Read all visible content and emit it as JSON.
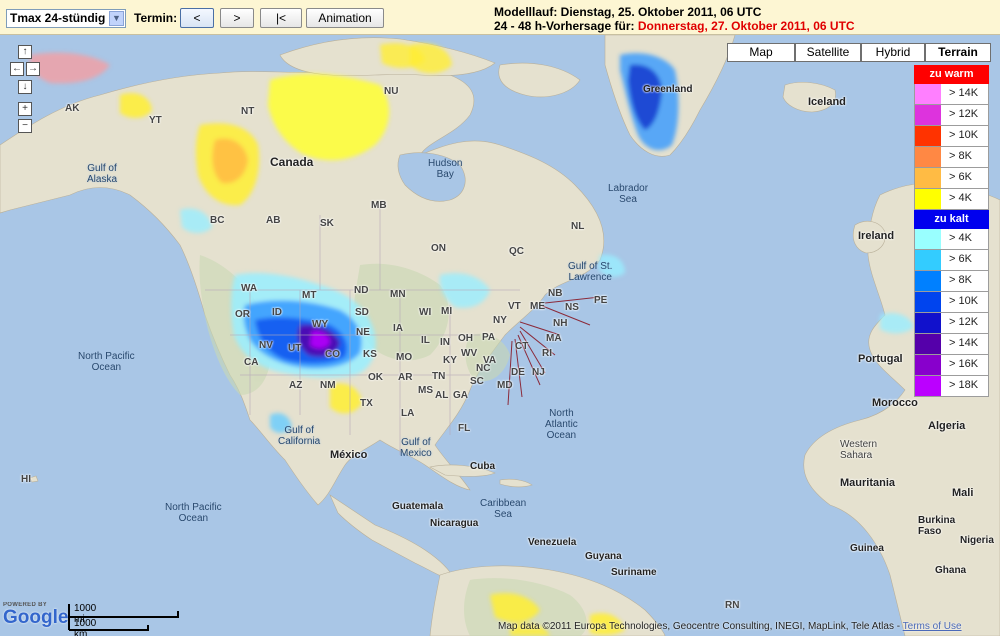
{
  "toolbar": {
    "select_value": "Tmax 24-stündig",
    "termin_label": "Termin:",
    "btn_prev": "<",
    "btn_next": ">",
    "btn_first": "|<",
    "btn_animation": "Animation",
    "run_line": "Modelllauf: Dienstag, 25. Oktober 2011, 06 UTC",
    "forecast_prefix": "24 - 48 h-Vorhersage für: ",
    "forecast_date": "Donnerstag, 27. Oktober 2011, 06 UTC"
  },
  "map_types": [
    "Map",
    "Satellite",
    "Hybrid",
    "Terrain"
  ],
  "map_type_active": "Terrain",
  "pan_controls": {
    "up": "↑",
    "left": "←",
    "right": "→",
    "down": "↓",
    "zoom_in": "+",
    "zoom_out": "−"
  },
  "legend": {
    "warm_title": "zu warm",
    "warm": [
      {
        "label": "> 14K",
        "color": "#ff7fff"
      },
      {
        "label": "> 12K",
        "color": "#dd33dd"
      },
      {
        "label": "> 10K",
        "color": "#ff3300"
      },
      {
        "label": "> 8K",
        "color": "#ff8844"
      },
      {
        "label": "> 6K",
        "color": "#ffbb44"
      },
      {
        "label": "> 4K",
        "color": "#ffff00"
      }
    ],
    "cold_title": "zu kalt",
    "cold": [
      {
        "label": "> 4K",
        "color": "#99ffff"
      },
      {
        "label": "> 6K",
        "color": "#33ccff"
      },
      {
        "label": "> 8K",
        "color": "#0080ff"
      },
      {
        "label": "> 10K",
        "color": "#0044ee"
      },
      {
        "label": "> 12K",
        "color": "#1111cc"
      },
      {
        "label": "> 14K",
        "color": "#5500aa"
      },
      {
        "label": "> 16K",
        "color": "#8800cc"
      },
      {
        "label": "> 18K",
        "color": "#bb00ff"
      }
    ],
    "warm_header_color": "#ff0000",
    "cold_header_color": "#0000ee"
  },
  "labels": {
    "canada": "Canada",
    "mexico": "México",
    "greenland": "Greenland",
    "iceland": "Iceland",
    "ireland": "Ireland",
    "portugal": "Portugal",
    "morocco": "Morocco",
    "algeria": "Algeria",
    "western_sahara": "Western\nSahara",
    "mauritania": "Mauritania",
    "mali": "Mali",
    "cuba": "Cuba",
    "guatemala": "Guatemala",
    "nicaragua": "Nicaragua",
    "caribbean": "Caribbean\nSea",
    "venezuela": "Venezuela",
    "guyana": "Guyana",
    "suriname": "Suriname",
    "burkina": "Burkina\nFaso",
    "guinea": "Guinea",
    "ghana": "Ghana",
    "nigeria": "Nigeria",
    "hudson_bay": "Hudson\nBay",
    "labrador_sea": "Labrador\nSea",
    "gulf_alaska": "Gulf of\nAlaska",
    "gulf_stlawrence": "Gulf of St.\nLawrence",
    "gulf_mexico": "Gulf of\nMexico",
    "gulf_california": "Gulf of\nCalifornia",
    "north_pacific_1": "North Pacific\nOcean",
    "north_pacific_2": "North Pacific\nOcean",
    "north_atlantic": "North\nAtlantic\nOcean",
    "ak": "AK",
    "yt": "YT",
    "nt": "NT",
    "nu": "NU",
    "bc": "BC",
    "ab": "AB",
    "sk": "SK",
    "mb": "MB",
    "on": "ON",
    "qc": "QC",
    "nl": "NL",
    "nb": "NB",
    "ns": "NS",
    "pe": "PE",
    "wa": "WA",
    "or": "OR",
    "ca": "CA",
    "nv": "NV",
    "id": "ID",
    "mt": "MT",
    "wy": "WY",
    "ut": "UT",
    "co": "CO",
    "az": "AZ",
    "nm": "NM",
    "nd": "ND",
    "sd": "SD",
    "ne": "NE",
    "ks": "KS",
    "ok": "OK",
    "tx": "TX",
    "mn": "MN",
    "ia": "IA",
    "mo": "MO",
    "ar": "AR",
    "la": "LA",
    "wi": "WI",
    "il": "IL",
    "mi": "MI",
    "in": "IN",
    "oh": "OH",
    "ky": "KY",
    "tn": "TN",
    "ms": "MS",
    "al": "AL",
    "ga": "GA",
    "fl": "FL",
    "sc": "SC",
    "nc": "NC",
    "va": "VA",
    "wv": "WV",
    "pa": "PA",
    "ny": "NY",
    "vt": "VT",
    "me": "ME",
    "nh": "NH",
    "ma": "MA",
    "ct": "CT",
    "ri": "RI",
    "nj": "NJ",
    "de": "DE",
    "md": "MD",
    "hi": "HI",
    "rn": "RN"
  },
  "scale": {
    "mi": "1000 mi",
    "km": "1000 km"
  },
  "powered_by": "POWERED BY",
  "google": "Google",
  "attribution": "Map data ©2011 Europa Technologies, Geocentre Consulting, INEGI, MapLink, Tele Atlas - ",
  "terms": "Terms of Use"
}
